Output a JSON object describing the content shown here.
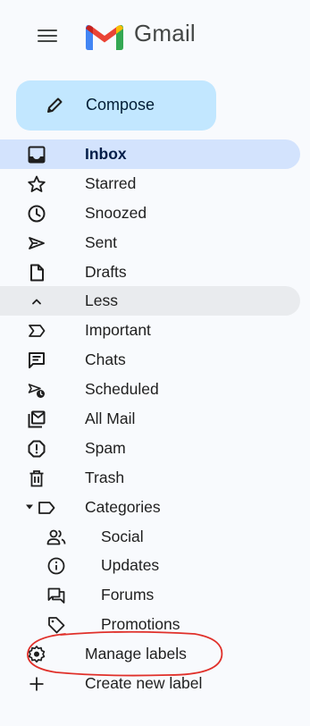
{
  "app": {
    "title": "Gmail"
  },
  "compose": {
    "label": "Compose",
    "icon": "pencil-icon"
  },
  "nav": {
    "inbox": {
      "label": "Inbox",
      "icon": "inbox-icon"
    },
    "starred": {
      "label": "Starred",
      "icon": "star-icon"
    },
    "snoozed": {
      "label": "Snoozed",
      "icon": "clock-icon"
    },
    "sent": {
      "label": "Sent",
      "icon": "send-icon"
    },
    "drafts": {
      "label": "Drafts",
      "icon": "draft-icon"
    },
    "less": {
      "label": "Less",
      "icon": "chevron-up-icon"
    },
    "important": {
      "label": "Important",
      "icon": "important-icon"
    },
    "chats": {
      "label": "Chats",
      "icon": "chat-icon"
    },
    "scheduled": {
      "label": "Scheduled",
      "icon": "scheduled-icon"
    },
    "all_mail": {
      "label": "All Mail",
      "icon": "all-mail-icon"
    },
    "spam": {
      "label": "Spam",
      "icon": "spam-icon"
    },
    "trash": {
      "label": "Trash",
      "icon": "trash-icon"
    },
    "categories": {
      "label": "Categories",
      "icon": "label-icon"
    },
    "social": {
      "label": "Social",
      "icon": "people-icon"
    },
    "updates": {
      "label": "Updates",
      "icon": "info-icon"
    },
    "forums": {
      "label": "Forums",
      "icon": "forum-icon"
    },
    "promotions": {
      "label": "Promotions",
      "icon": "tag-icon"
    },
    "manage_labels": {
      "label": "Manage labels",
      "icon": "gear-icon"
    },
    "create_label": {
      "label": "Create new label",
      "icon": "plus-icon"
    }
  },
  "colors": {
    "background": "#f8fafd",
    "compose_bg": "#c2e7ff",
    "active_bg": "#d3e3fd",
    "less_bg": "#e9ebee",
    "annotation": "#e0302a",
    "gmail_red": "#ea4335",
    "gmail_blue": "#4285f4",
    "gmail_green": "#34a853",
    "gmail_yellow": "#fbbc04"
  }
}
